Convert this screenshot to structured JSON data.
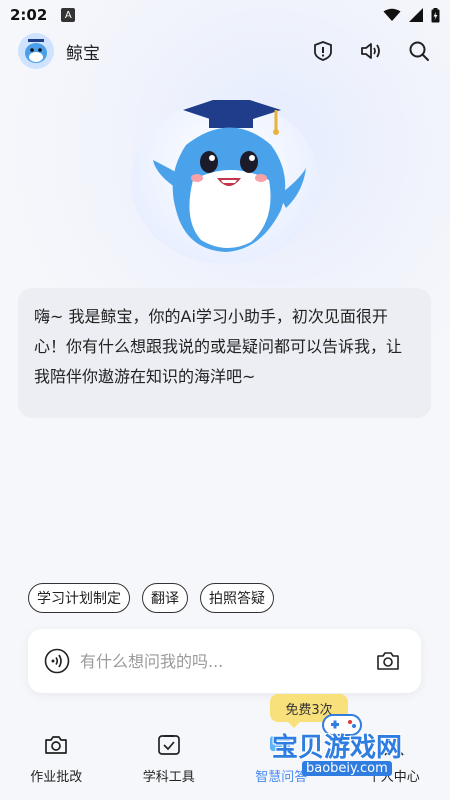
{
  "status": {
    "time": "2:02",
    "app_badge": "A"
  },
  "header": {
    "title": "鲸宝"
  },
  "message": {
    "text": "嗨~ 我是鲸宝，你的Ai学习小助手，初次见面很开心！你有什么想跟我说的或是疑问都可以告诉我，让我陪伴你遨游在知识的海洋吧~"
  },
  "chips": [
    "学习计划制定",
    "翻译",
    "拍照答疑"
  ],
  "input": {
    "placeholder": "有什么想问我的吗..."
  },
  "badge": {
    "free": "免费3次"
  },
  "tabs": [
    {
      "label": "作业批改",
      "icon": "camera-icon"
    },
    {
      "label": "学科工具",
      "icon": "checkbox-icon"
    },
    {
      "label": "智慧问答",
      "icon": "chat-icon"
    },
    {
      "label": "个人中心",
      "icon": "person-icon"
    }
  ],
  "watermark": {
    "line1": "宝贝游戏网",
    "line2": "baobeiy.com"
  },
  "colors": {
    "accent": "#4a8cf2",
    "badge": "#f8e07a",
    "bubble": "#eceef3"
  }
}
